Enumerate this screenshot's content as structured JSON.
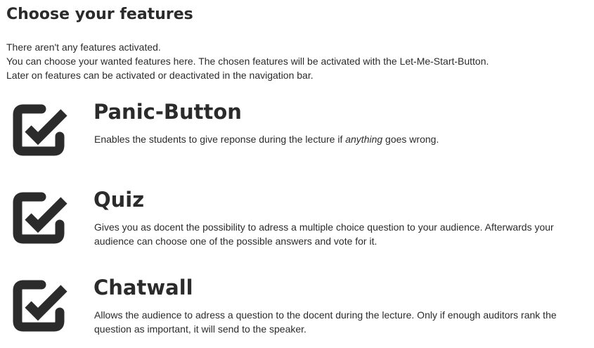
{
  "page": {
    "title": "Choose your features"
  },
  "intro": {
    "line1": "There aren't any features activated.",
    "line2": "You can choose your wanted features here. The chosen features will be activated with the Let-Me-Start-Button.",
    "line3": "Later on features can be activated or deactivated in the navigation bar."
  },
  "features": [
    {
      "name": "Panic-Button",
      "desc_before": "Enables the students to give reponse during the lecture if ",
      "desc_emphasis": "anything",
      "desc_after": " goes wrong.",
      "checked": true,
      "icon": "checkbox-checked-icon"
    },
    {
      "name": "Quiz",
      "desc": "Gives you as docent the possibility to adress a multiple choice question to your audience. Afterwards your audience can choose one of the possible answers and vote for it.",
      "checked": true,
      "icon": "checkbox-checked-icon"
    },
    {
      "name": "Chatwall",
      "desc": "Allows the audience to adress a question to the docent during the lecture. Only if enough auditors rank the question as important, it will send to the speaker.",
      "checked": true,
      "icon": "checkbox-checked-icon"
    }
  ],
  "colors": {
    "text": "#2b2b2b",
    "icon": "#2b2b2b",
    "background": "#ffffff"
  }
}
